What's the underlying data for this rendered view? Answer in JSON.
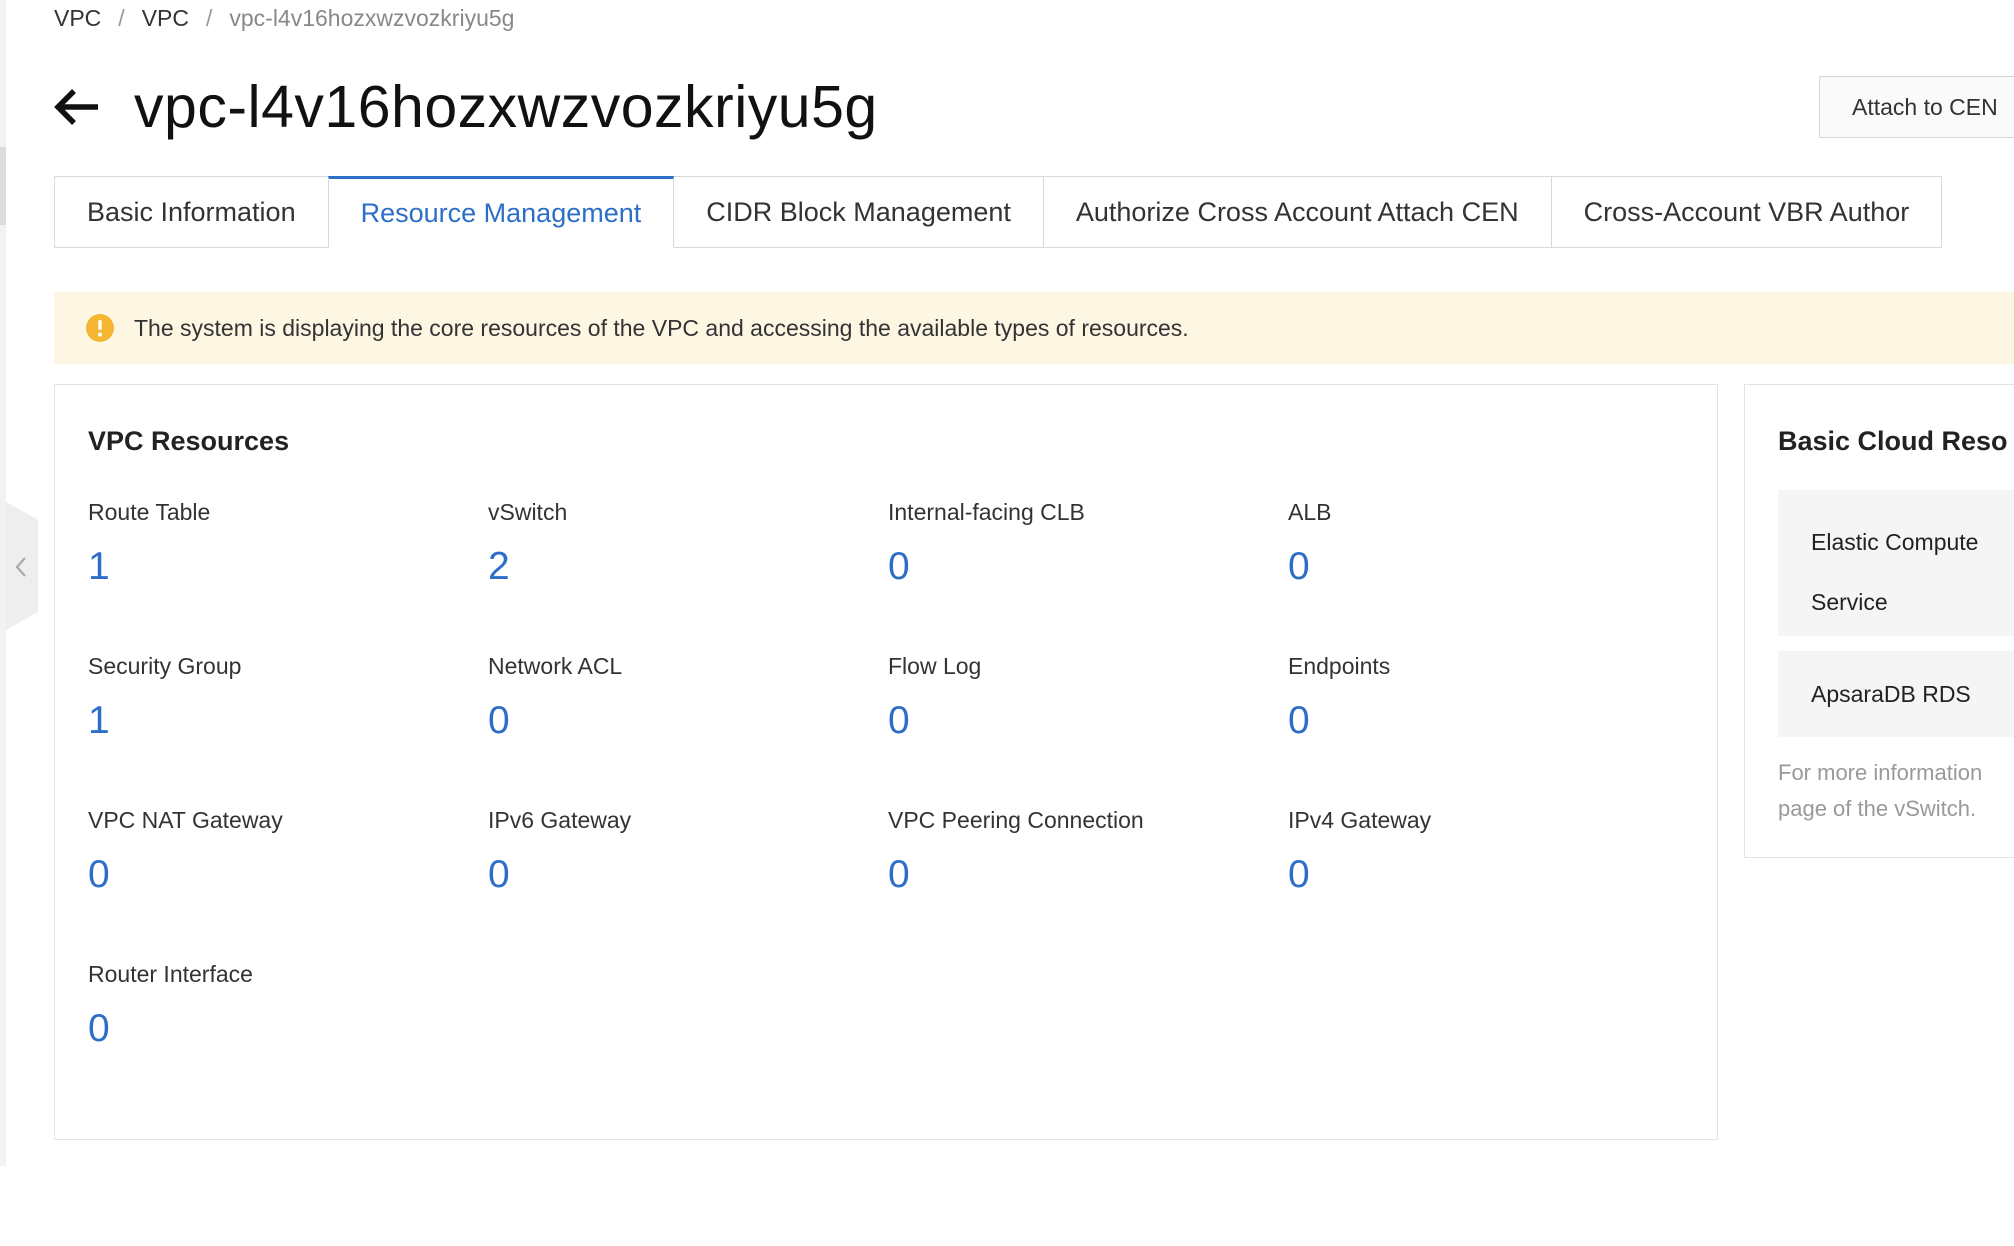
{
  "breadcrumb": {
    "items": [
      "VPC",
      "VPC"
    ],
    "separator": "/",
    "current": "vpc-l4v16hozxwzvozkriyu5g"
  },
  "header": {
    "title": "vpc-l4v16hozxwzvozkriyu5g",
    "attach_button": "Attach to CEN"
  },
  "tabs": [
    {
      "label": "Basic Information",
      "active": false
    },
    {
      "label": "Resource Management",
      "active": true
    },
    {
      "label": "CIDR Block Management",
      "active": false
    },
    {
      "label": "Authorize Cross Account Attach CEN",
      "active": false
    },
    {
      "label": "Cross-Account VBR Author",
      "active": false
    }
  ],
  "alert": {
    "text": "The system is displaying the core resources of the VPC and accessing the available types of resources."
  },
  "vpc_resources": {
    "title": "VPC Resources",
    "items": [
      {
        "label": "Route Table",
        "count": "1"
      },
      {
        "label": "vSwitch",
        "count": "2"
      },
      {
        "label": "Internal-facing CLB",
        "count": "0"
      },
      {
        "label": "ALB",
        "count": "0"
      },
      {
        "label": "Security Group",
        "count": "1"
      },
      {
        "label": "Network ACL",
        "count": "0"
      },
      {
        "label": "Flow Log",
        "count": "0"
      },
      {
        "label": "Endpoints",
        "count": "0"
      },
      {
        "label": "VPC NAT Gateway",
        "count": "0"
      },
      {
        "label": "IPv6 Gateway",
        "count": "0"
      },
      {
        "label": "VPC Peering Connection",
        "count": "0"
      },
      {
        "label": "IPv4 Gateway",
        "count": "0"
      },
      {
        "label": "Router Interface",
        "count": "0"
      }
    ]
  },
  "basic_cloud": {
    "title": "Basic Cloud Reso",
    "items": [
      {
        "line1": "Elastic Compute",
        "line2": "Service"
      },
      {
        "line1": "ApsaraDB RDS"
      }
    ],
    "note_line1": "For more information",
    "note_line2": "page of the vSwitch."
  },
  "colors": {
    "accent": "#2d6fc8",
    "alert_bg": "#fdf6e3",
    "warning_icon": "#f5b731"
  },
  "icons": {
    "back": "arrow-left-icon",
    "alert": "warning-circle-icon",
    "collapse": "chevron-left-icon"
  }
}
